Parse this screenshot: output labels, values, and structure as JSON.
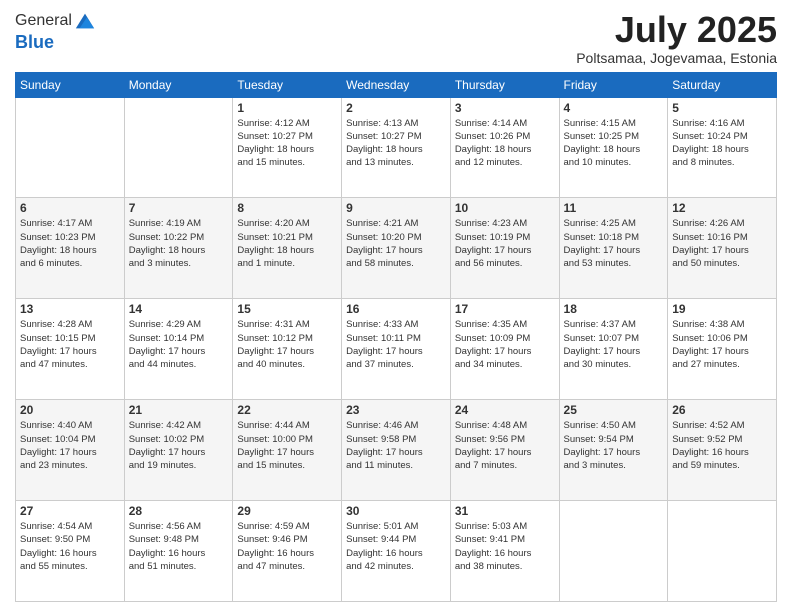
{
  "logo": {
    "general": "General",
    "blue": "Blue"
  },
  "title": "July 2025",
  "location": "Poltsamaa, Jogevamaa, Estonia",
  "days_header": [
    "Sunday",
    "Monday",
    "Tuesday",
    "Wednesday",
    "Thursday",
    "Friday",
    "Saturday"
  ],
  "weeks": [
    [
      {
        "day": "",
        "info": ""
      },
      {
        "day": "",
        "info": ""
      },
      {
        "day": "1",
        "info": "Sunrise: 4:12 AM\nSunset: 10:27 PM\nDaylight: 18 hours\nand 15 minutes."
      },
      {
        "day": "2",
        "info": "Sunrise: 4:13 AM\nSunset: 10:27 PM\nDaylight: 18 hours\nand 13 minutes."
      },
      {
        "day": "3",
        "info": "Sunrise: 4:14 AM\nSunset: 10:26 PM\nDaylight: 18 hours\nand 12 minutes."
      },
      {
        "day": "4",
        "info": "Sunrise: 4:15 AM\nSunset: 10:25 PM\nDaylight: 18 hours\nand 10 minutes."
      },
      {
        "day": "5",
        "info": "Sunrise: 4:16 AM\nSunset: 10:24 PM\nDaylight: 18 hours\nand 8 minutes."
      }
    ],
    [
      {
        "day": "6",
        "info": "Sunrise: 4:17 AM\nSunset: 10:23 PM\nDaylight: 18 hours\nand 6 minutes."
      },
      {
        "day": "7",
        "info": "Sunrise: 4:19 AM\nSunset: 10:22 PM\nDaylight: 18 hours\nand 3 minutes."
      },
      {
        "day": "8",
        "info": "Sunrise: 4:20 AM\nSunset: 10:21 PM\nDaylight: 18 hours\nand 1 minute."
      },
      {
        "day": "9",
        "info": "Sunrise: 4:21 AM\nSunset: 10:20 PM\nDaylight: 17 hours\nand 58 minutes."
      },
      {
        "day": "10",
        "info": "Sunrise: 4:23 AM\nSunset: 10:19 PM\nDaylight: 17 hours\nand 56 minutes."
      },
      {
        "day": "11",
        "info": "Sunrise: 4:25 AM\nSunset: 10:18 PM\nDaylight: 17 hours\nand 53 minutes."
      },
      {
        "day": "12",
        "info": "Sunrise: 4:26 AM\nSunset: 10:16 PM\nDaylight: 17 hours\nand 50 minutes."
      }
    ],
    [
      {
        "day": "13",
        "info": "Sunrise: 4:28 AM\nSunset: 10:15 PM\nDaylight: 17 hours\nand 47 minutes."
      },
      {
        "day": "14",
        "info": "Sunrise: 4:29 AM\nSunset: 10:14 PM\nDaylight: 17 hours\nand 44 minutes."
      },
      {
        "day": "15",
        "info": "Sunrise: 4:31 AM\nSunset: 10:12 PM\nDaylight: 17 hours\nand 40 minutes."
      },
      {
        "day": "16",
        "info": "Sunrise: 4:33 AM\nSunset: 10:11 PM\nDaylight: 17 hours\nand 37 minutes."
      },
      {
        "day": "17",
        "info": "Sunrise: 4:35 AM\nSunset: 10:09 PM\nDaylight: 17 hours\nand 34 minutes."
      },
      {
        "day": "18",
        "info": "Sunrise: 4:37 AM\nSunset: 10:07 PM\nDaylight: 17 hours\nand 30 minutes."
      },
      {
        "day": "19",
        "info": "Sunrise: 4:38 AM\nSunset: 10:06 PM\nDaylight: 17 hours\nand 27 minutes."
      }
    ],
    [
      {
        "day": "20",
        "info": "Sunrise: 4:40 AM\nSunset: 10:04 PM\nDaylight: 17 hours\nand 23 minutes."
      },
      {
        "day": "21",
        "info": "Sunrise: 4:42 AM\nSunset: 10:02 PM\nDaylight: 17 hours\nand 19 minutes."
      },
      {
        "day": "22",
        "info": "Sunrise: 4:44 AM\nSunset: 10:00 PM\nDaylight: 17 hours\nand 15 minutes."
      },
      {
        "day": "23",
        "info": "Sunrise: 4:46 AM\nSunset: 9:58 PM\nDaylight: 17 hours\nand 11 minutes."
      },
      {
        "day": "24",
        "info": "Sunrise: 4:48 AM\nSunset: 9:56 PM\nDaylight: 17 hours\nand 7 minutes."
      },
      {
        "day": "25",
        "info": "Sunrise: 4:50 AM\nSunset: 9:54 PM\nDaylight: 17 hours\nand 3 minutes."
      },
      {
        "day": "26",
        "info": "Sunrise: 4:52 AM\nSunset: 9:52 PM\nDaylight: 16 hours\nand 59 minutes."
      }
    ],
    [
      {
        "day": "27",
        "info": "Sunrise: 4:54 AM\nSunset: 9:50 PM\nDaylight: 16 hours\nand 55 minutes."
      },
      {
        "day": "28",
        "info": "Sunrise: 4:56 AM\nSunset: 9:48 PM\nDaylight: 16 hours\nand 51 minutes."
      },
      {
        "day": "29",
        "info": "Sunrise: 4:59 AM\nSunset: 9:46 PM\nDaylight: 16 hours\nand 47 minutes."
      },
      {
        "day": "30",
        "info": "Sunrise: 5:01 AM\nSunset: 9:44 PM\nDaylight: 16 hours\nand 42 minutes."
      },
      {
        "day": "31",
        "info": "Sunrise: 5:03 AM\nSunset: 9:41 PM\nDaylight: 16 hours\nand 38 minutes."
      },
      {
        "day": "",
        "info": ""
      },
      {
        "day": "",
        "info": ""
      }
    ]
  ]
}
